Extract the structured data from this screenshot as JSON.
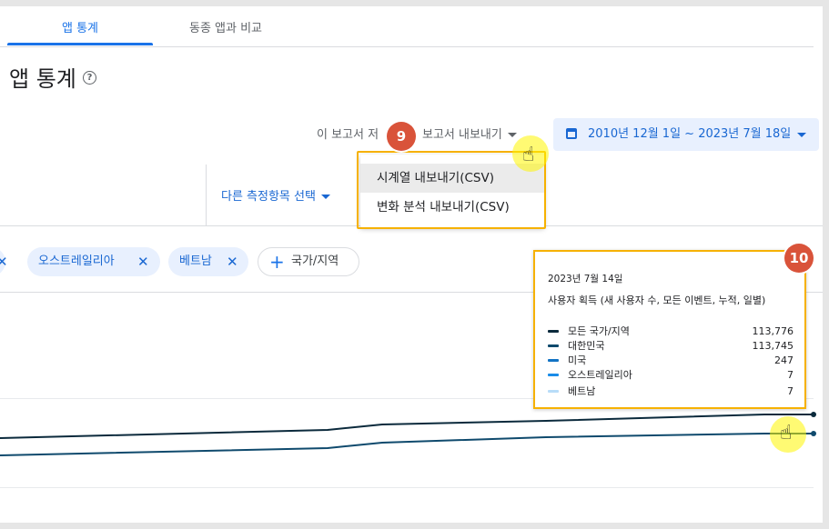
{
  "tabs": [
    {
      "label": "앱 통계"
    },
    {
      "label": "동종 앱과 비교"
    }
  ],
  "page_title": "앱 통계",
  "help_icon": "help-circle-icon",
  "export": {
    "label": "이 보고서 저",
    "menu_label": "보고서 내보내기",
    "options": [
      {
        "label": "시계열 내보내기(CSV)"
      },
      {
        "label": "변화 분석 내보내기(CSV)"
      }
    ]
  },
  "date_range": "2010년 12월 1일 ~ 2023년 7월 18일",
  "metric_select": "다른 측정항목 선택",
  "chips": [
    {
      "label": "오스트레일리아"
    },
    {
      "label": "베트남"
    }
  ],
  "add_chip": "국가/지역",
  "badges": {
    "step9": "9",
    "step10": "10"
  },
  "tooltip": {
    "date": "2023년 7월 14일",
    "metric": "사용자 획득 (새 사용자 수, 모든 이벤트, 누적, 일별)",
    "rows": [
      {
        "name": "모든 국가/지역",
        "value": "113,776",
        "color": "#0b2a3c"
      },
      {
        "name": "대한민국",
        "value": "113,745",
        "color": "#0f4a6d"
      },
      {
        "name": "미국",
        "value": "247",
        "color": "#1273c4"
      },
      {
        "name": "오스트레일리아",
        "value": "7",
        "color": "#1a8ce8"
      },
      {
        "name": "베트남",
        "value": "7",
        "color": "#b8dcf8"
      }
    ]
  },
  "colors": {
    "accent": "#1a73e8",
    "highlight": "#f6b100",
    "badge": "#d9533a"
  }
}
